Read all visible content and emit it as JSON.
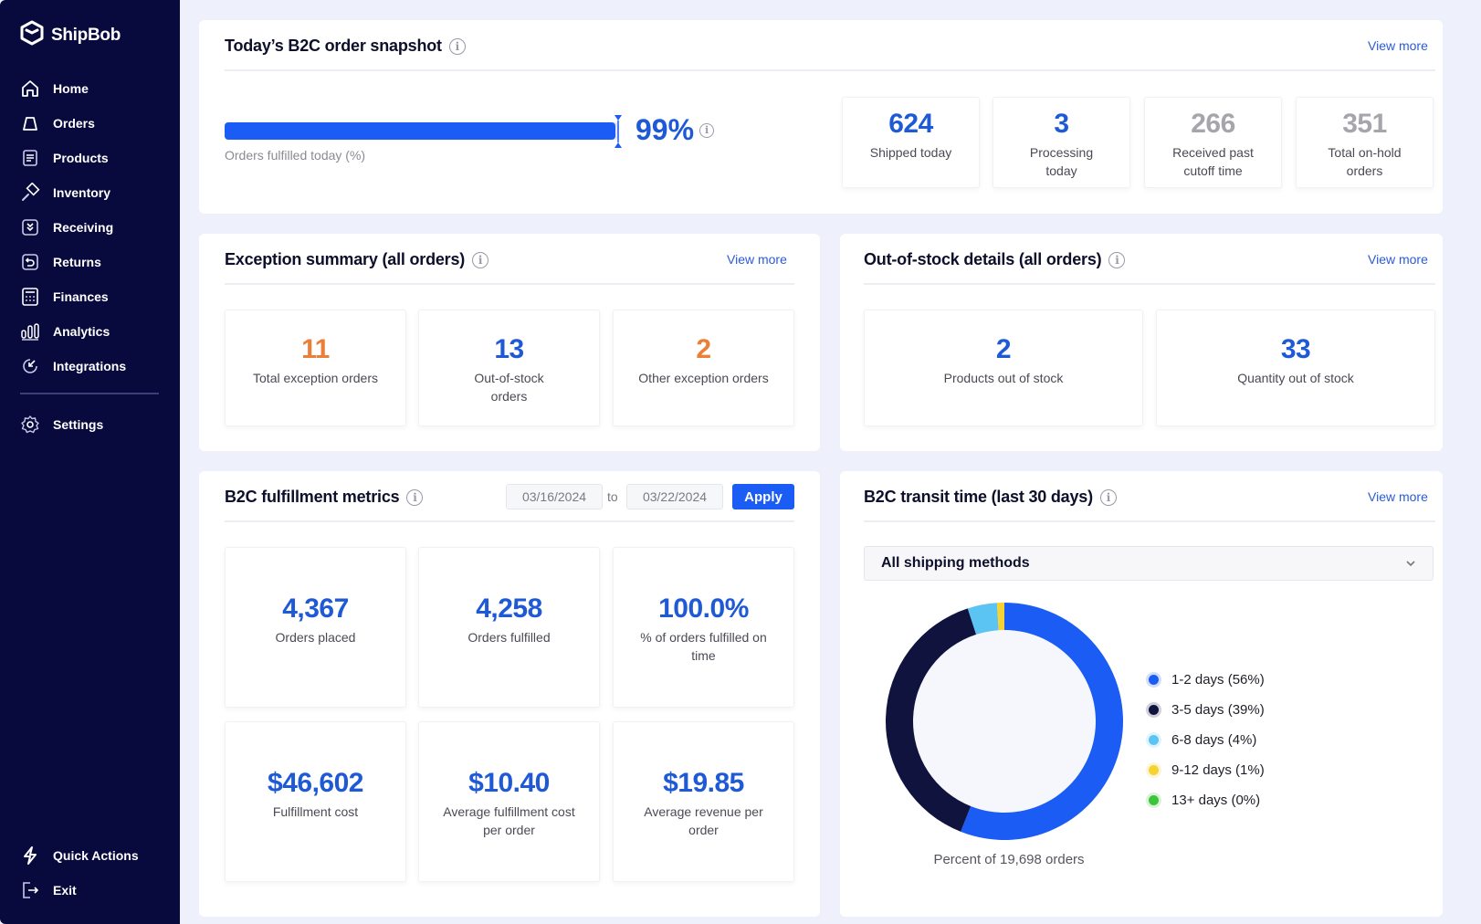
{
  "brand": {
    "name": "ShipBob",
    "accent": "#1b5cf5",
    "sidebar_bg": "#080a3d"
  },
  "sidebar": {
    "items": [
      {
        "label": "Home",
        "icon": "home-icon"
      },
      {
        "label": "Orders",
        "icon": "bag-icon"
      },
      {
        "label": "Products",
        "icon": "document-icon"
      },
      {
        "label": "Inventory",
        "icon": "hammer-icon"
      },
      {
        "label": "Receiving",
        "icon": "receiving-icon"
      },
      {
        "label": "Returns",
        "icon": "return-icon"
      },
      {
        "label": "Finances",
        "icon": "calculator-icon"
      },
      {
        "label": "Analytics",
        "icon": "bar-chart-icon"
      },
      {
        "label": "Integrations",
        "icon": "integrations-icon"
      }
    ],
    "settings": {
      "label": "Settings",
      "icon": "gear-icon"
    },
    "bottom": [
      {
        "label": "Quick Actions",
        "icon": "lightning-icon"
      },
      {
        "label": "Exit",
        "icon": "exit-icon"
      }
    ]
  },
  "snapshot": {
    "title": "Today’s B2C order snapshot",
    "view_more": "View more",
    "progress": {
      "value_percent": 99,
      "display": "99%",
      "label": "Orders fulfilled today (%)"
    },
    "stats": [
      {
        "value": "624",
        "label": "Shipped today",
        "tone": "blue"
      },
      {
        "value": "3",
        "label": "Processing today",
        "tone": "blue"
      },
      {
        "value": "266",
        "label": "Received past cutoff time",
        "tone": "gray"
      },
      {
        "value": "351",
        "label": "Total on-hold orders",
        "tone": "gray"
      }
    ]
  },
  "exceptions": {
    "title": "Exception summary (all orders)",
    "view_more": "View more",
    "stats": [
      {
        "value": "11",
        "label": "Total exception orders",
        "tone": "orange"
      },
      {
        "value": "13",
        "label": "Out-of-stock orders",
        "tone": "blue"
      },
      {
        "value": "2",
        "label": "Other exception orders",
        "tone": "orange"
      }
    ]
  },
  "out_of_stock": {
    "title": "Out-of-stock details (all orders)",
    "view_more": "View more",
    "stats": [
      {
        "value": "2",
        "label": "Products out of stock",
        "tone": "blue"
      },
      {
        "value": "33",
        "label": "Quantity out of stock",
        "tone": "blue"
      }
    ]
  },
  "metrics": {
    "title": "B2C fulfillment metrics",
    "date_from": "03/16/2024",
    "date_to": "03/22/2024",
    "to_label": "to",
    "apply_label": "Apply",
    "stats": [
      {
        "value": "4,367",
        "label": "Orders placed"
      },
      {
        "value": "4,258",
        "label": "Orders fulfilled"
      },
      {
        "value": "100.0%",
        "label": "% of orders fulfilled on time"
      },
      {
        "value": "$46,602",
        "label": "Fulfillment cost"
      },
      {
        "value": "$10.40",
        "label": "Average fulfillment cost per order"
      },
      {
        "value": "$19.85",
        "label": "Average revenue per order"
      }
    ]
  },
  "transit": {
    "title": "B2C transit time (last 30 days)",
    "view_more": "View more",
    "select_value": "All shipping methods",
    "caption": "Percent of 19,698 orders"
  },
  "chart_data": {
    "type": "pie",
    "title": "B2C transit time (last 30 days)",
    "categories": [
      "1-2 days",
      "3-5 days",
      "6-8 days",
      "9-12 days",
      "13+ days"
    ],
    "values": [
      56,
      39,
      4,
      1,
      0
    ],
    "legend_labels": [
      "1-2 days (56%)",
      "3-5 days (39%)",
      "6-8 days (4%)",
      "9-12 days (1%)",
      "13+ days (0%)"
    ],
    "colors": [
      "#1b5cf5",
      "#11133f",
      "#5cc4f2",
      "#f6d232",
      "#3cc43c"
    ],
    "legend_position": "right",
    "total_orders": "19,698",
    "donut": true
  }
}
